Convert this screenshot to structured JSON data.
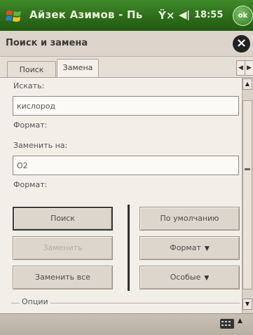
{
  "statusbar": {
    "title": "Айзек Азимов - Пь",
    "clock": "18:55",
    "ok_label": "ok",
    "signal_icon": "signal-antenna-icon",
    "volume_icon": "speaker-volume-icon"
  },
  "dialog": {
    "title": "Поиск и замена",
    "close_icon": "close-icon"
  },
  "tabs": [
    {
      "label": "Поиск",
      "active": false
    },
    {
      "label": "Замена",
      "active": true
    }
  ],
  "form": {
    "find_label": "Искать:",
    "find_value": "кислород",
    "find_format_label": "Формат:",
    "replace_label": "Заменить на:",
    "replace_value": "O2",
    "replace_format_label": "Формат:"
  },
  "buttons": {
    "find": "Поиск",
    "replace": "Заменить",
    "replace_all": "Заменить все",
    "default": "По умолчанию",
    "format": "Формат",
    "special": "Особые"
  },
  "options_label": "Опции",
  "colors": {
    "titlebar": "#2c6a18",
    "dialog_background": "#f2eee8",
    "button_face": "#ddd6cc"
  }
}
